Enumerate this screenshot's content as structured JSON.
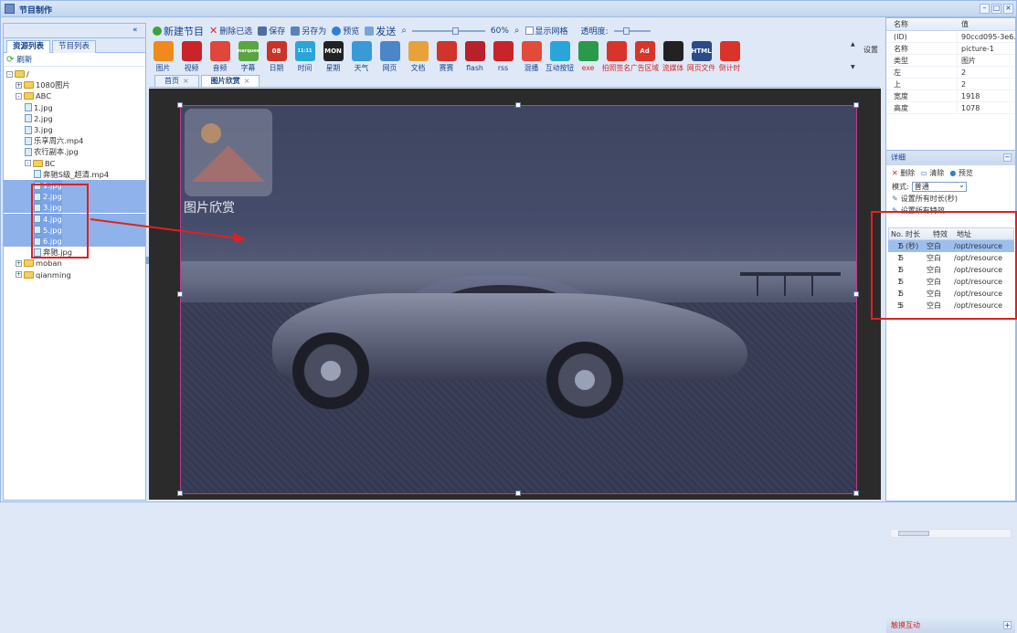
{
  "window": {
    "title": "节目制作"
  },
  "left": {
    "tabs": [
      "资源列表",
      "节目列表"
    ],
    "refresh": "刷新",
    "tree": [
      {
        "label": "/",
        "level": 0,
        "type": "folder",
        "expand": "-"
      },
      {
        "label": "1080图片",
        "level": 1,
        "type": "folder",
        "expand": "+"
      },
      {
        "label": "ABC",
        "level": 1,
        "type": "folder",
        "expand": "-"
      },
      {
        "label": "1.jpg",
        "level": 2,
        "type": "file"
      },
      {
        "label": "2.jpg",
        "level": 2,
        "type": "file"
      },
      {
        "label": "3.jpg",
        "level": 2,
        "type": "file"
      },
      {
        "label": "乐享周六.mp4",
        "level": 2,
        "type": "file"
      },
      {
        "label": "农行副本.jpg",
        "level": 2,
        "type": "file"
      },
      {
        "label": "BC",
        "level": 2,
        "type": "folder",
        "expand": "-"
      },
      {
        "label": "奔驰S级_超清.mp4",
        "level": 3,
        "type": "file"
      },
      {
        "label": "1.jpg",
        "level": 3,
        "type": "file",
        "selected": true
      },
      {
        "label": "2.jpg",
        "level": 3,
        "type": "file",
        "selected": true
      },
      {
        "label": "3.jpg",
        "level": 3,
        "type": "file",
        "selected": true
      },
      {
        "label": "4.jpg",
        "level": 3,
        "type": "file",
        "selected": true
      },
      {
        "label": "5.jpg",
        "level": 3,
        "type": "file",
        "selected": true
      },
      {
        "label": "6.jpg",
        "level": 3,
        "type": "file",
        "selected": true
      },
      {
        "label": "奔驰.jpg",
        "level": 3,
        "type": "file"
      },
      {
        "label": "moban",
        "level": 1,
        "type": "folder",
        "expand": "+"
      },
      {
        "label": "qianming",
        "level": 1,
        "type": "folder",
        "expand": "+"
      }
    ]
  },
  "toolbar": {
    "new": "新建节目",
    "delete_selected": "删除已选",
    "save": "保存",
    "save_as": "另存为",
    "preview": "预览",
    "send": "发送",
    "zoom": "60%",
    "show_grid": "显示网格",
    "opacity": "透明度:",
    "zoom_level": 0.6,
    "opacity_level": 0.25
  },
  "tools": [
    {
      "label": "图片",
      "icon": "image-icon",
      "color": "#f08a1c"
    },
    {
      "label": "视频",
      "icon": "video-icon",
      "color": "#c8242a"
    },
    {
      "label": "音频",
      "icon": "audio-icon",
      "color": "#e0463a"
    },
    {
      "label": "字幕",
      "icon": "marquee-icon",
      "color": "#5aa441",
      "text": "marquee"
    },
    {
      "label": "日期",
      "icon": "calendar-icon",
      "color": "#c8342a",
      "text": "08"
    },
    {
      "label": "时间",
      "icon": "clock-icon",
      "color": "#2aa5d8",
      "text": "11:11"
    },
    {
      "label": "星期",
      "icon": "week-icon",
      "color": "#222222",
      "text": "MON"
    },
    {
      "label": "天气",
      "icon": "weather-icon",
      "color": "#3a9ad8"
    },
    {
      "label": "网页",
      "icon": "web-icon",
      "color": "#4a86c8"
    },
    {
      "label": "文档",
      "icon": "document-icon",
      "color": "#e8a23a"
    },
    {
      "label": "赛赛",
      "icon": "race-icon",
      "color": "#d0342a"
    },
    {
      "label": "flash",
      "icon": "flash-icon",
      "color": "#b8202a"
    },
    {
      "label": "rss",
      "icon": "rss-icon",
      "color": "#c8242a"
    },
    {
      "label": "混播",
      "icon": "mixed-icon",
      "color": "#e24a3a"
    },
    {
      "label": "互动按钮",
      "icon": "interactive-icon",
      "color": "#2aa5d8"
    },
    {
      "label": "exe",
      "icon": "exe-icon",
      "color": "#2a9a4a",
      "red": true
    },
    {
      "label": "拍照签名",
      "icon": "camera-sign-icon",
      "color": "#d8342a",
      "red": true
    },
    {
      "label": "广告区域",
      "icon": "ad-icon",
      "color": "#d8342a",
      "text": "Ad",
      "red": true
    },
    {
      "label": "流媒体",
      "icon": "stream-icon",
      "color": "#222222",
      "red": true
    },
    {
      "label": "网页文件",
      "icon": "html-icon",
      "color": "#2a4a8a",
      "text": "HTML",
      "red": true
    },
    {
      "label": "倒计时",
      "icon": "countdown-icon",
      "color": "#d8342a",
      "red": true
    }
  ],
  "settings": "设置",
  "doctabs": [
    {
      "label": "首页",
      "active": false
    },
    {
      "label": "图片欣赏",
      "active": true
    }
  ],
  "canvas": {
    "widget_title": "图片欣赏"
  },
  "properties": {
    "headers": [
      "名称",
      "值"
    ],
    "rows": [
      {
        "name": "(ID)",
        "value": "90ccd095-3e6..."
      },
      {
        "name": "名称",
        "value": "picture-1"
      },
      {
        "name": "类型",
        "value": "图片"
      },
      {
        "name": "左",
        "value": "2"
      },
      {
        "name": "上",
        "value": "2"
      },
      {
        "name": "宽度",
        "value": "1918"
      },
      {
        "name": "高度",
        "value": "1078"
      }
    ]
  },
  "detail": {
    "title": "详细",
    "delete": "删除",
    "clear": "清除",
    "preview": "预览",
    "mode_label": "模式:",
    "mode_value": "普通",
    "set_duration": "设置所有时长(秒)",
    "set_effect": "设置所有特效",
    "grid_headers": [
      "No.",
      "时长(秒)",
      "特效",
      "地址"
    ],
    "grid_rows": [
      {
        "no": "1",
        "duration": "5",
        "effect": "空白",
        "path": "/opt/resource"
      },
      {
        "no": "1",
        "duration": "5",
        "effect": "空白",
        "path": "/opt/resource"
      },
      {
        "no": "1",
        "duration": "5",
        "effect": "空白",
        "path": "/opt/resource"
      },
      {
        "no": "1",
        "duration": "5",
        "effect": "空白",
        "path": "/opt/resource"
      },
      {
        "no": "1",
        "duration": "5",
        "effect": "空白",
        "path": "/opt/resource"
      },
      {
        "no": "5",
        "duration": "5",
        "effect": "空白",
        "path": "/opt/resource"
      }
    ],
    "bottom_tab": "触摸互动"
  },
  "colors": {
    "accent": "#15428b",
    "panel": "#dfe8f6",
    "border": "#99bbe8",
    "highlight": "#e02020"
  }
}
